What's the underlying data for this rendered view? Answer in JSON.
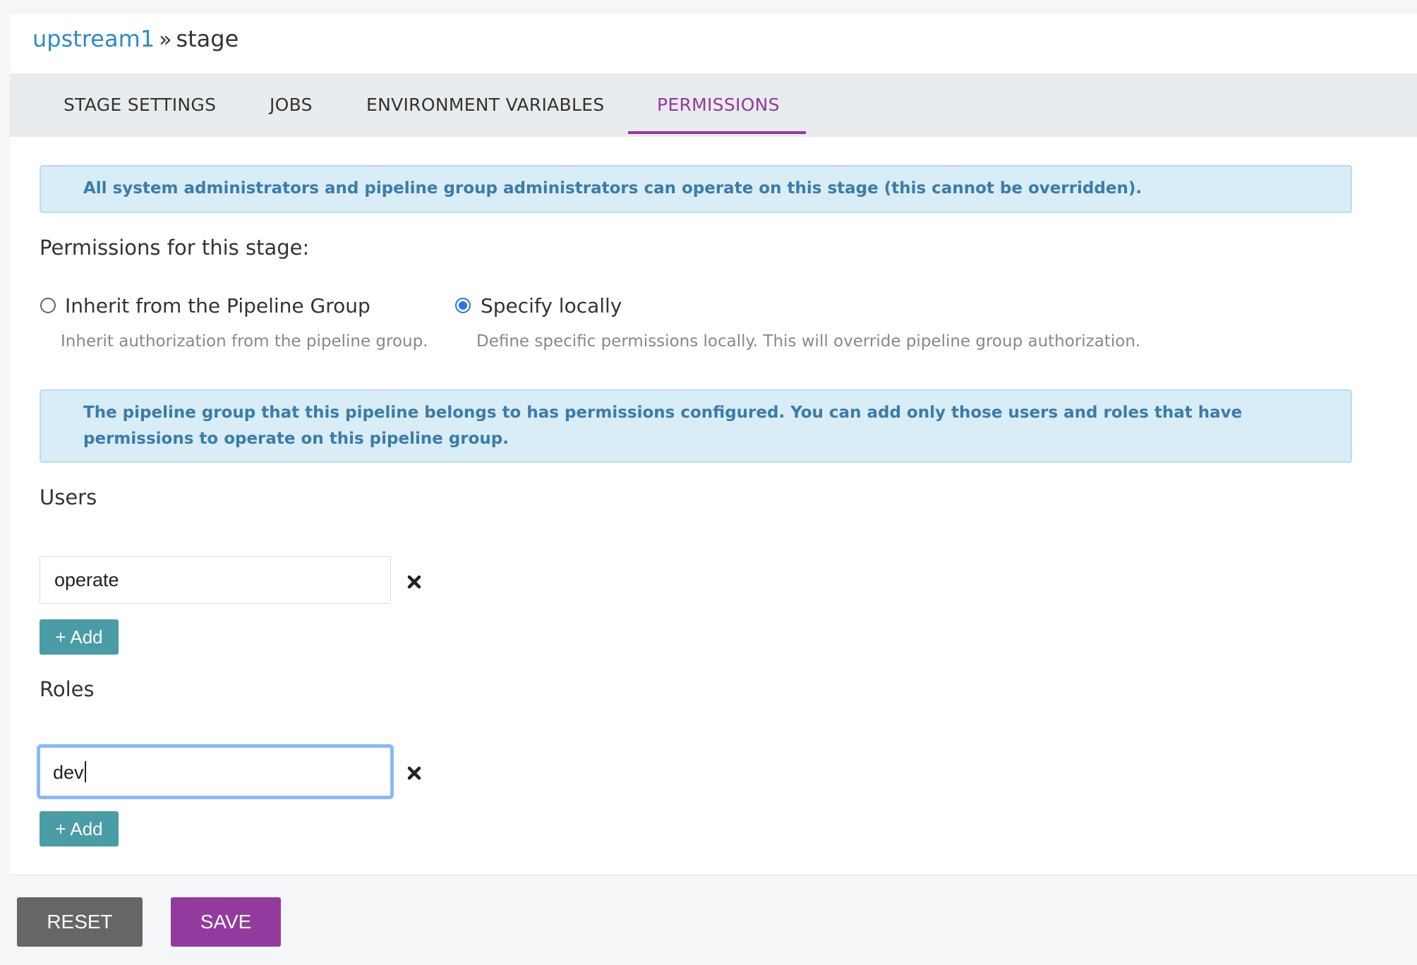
{
  "breadcrumb": {
    "pipeline": "upstream1",
    "separator": "»",
    "stage": "stage"
  },
  "tabs": [
    {
      "label": "STAGE SETTINGS",
      "active": false
    },
    {
      "label": "JOBS",
      "active": false
    },
    {
      "label": "ENVIRONMENT VARIABLES",
      "active": false
    },
    {
      "label": "PERMISSIONS",
      "active": true
    }
  ],
  "admin_notice": "All system administrators and pipeline group administrators can operate on this stage (this cannot be overridden).",
  "permissions_heading": "Permissions for this stage:",
  "options": {
    "inherit": {
      "label": "Inherit from the Pipeline Group",
      "help": "Inherit authorization from the pipeline group.",
      "selected": false
    },
    "local": {
      "label": "Specify locally",
      "help": "Define specific permissions locally. This will override pipeline group authorization.",
      "selected": true
    }
  },
  "group_notice": "The pipeline group that this pipeline belongs to has permissions configured. You can add only those users and roles that have permissions to operate on this pipeline group.",
  "users": {
    "heading": "Users",
    "entries": [
      "operate"
    ],
    "add_label": "+ Add"
  },
  "roles": {
    "heading": "Roles",
    "entries": [
      "dev"
    ],
    "add_label": "+ Add"
  },
  "actions": {
    "reset_label": "RESET",
    "save_label": "SAVE"
  },
  "colors": {
    "accent": "#943a9e",
    "link": "#2c8ac5",
    "add_button": "#4a9ca6",
    "reset_button": "#666666",
    "info_background": "#d9edf7"
  }
}
